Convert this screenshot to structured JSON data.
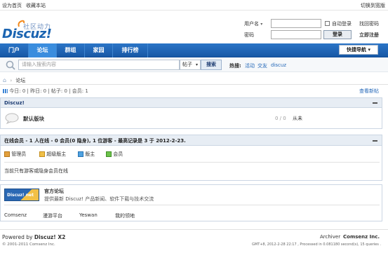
{
  "topbar": {
    "set_home": "设为首页",
    "bookmark": "收藏本站",
    "switch_width": "切换到宽版"
  },
  "logo": {
    "slogan": "社区动力",
    "wordmark": "Discuz!"
  },
  "login": {
    "username_label": "用户名",
    "password_label": "密码",
    "auto_login": "自动登录",
    "forgot_password": "找回密码",
    "login_button": "登录",
    "register": "立即注册"
  },
  "nav": {
    "items": [
      "门户",
      "论坛",
      "群组",
      "家园",
      "排行榜"
    ],
    "active": "论坛",
    "quick_nav": "快捷导航"
  },
  "search": {
    "placeholder": "请输入搜索内容",
    "type": "帖子",
    "button": "搜索",
    "hot_label": "热搜:",
    "hot_terms": [
      "活动",
      "交友",
      "discuz"
    ]
  },
  "breadcrumb": {
    "current": "论坛"
  },
  "stats": {
    "text": "今日: 0 | 昨日: 0 | 帖子: 0 | 会员: 1",
    "new_posts": "查看新帖"
  },
  "category": {
    "name": "Discuz!",
    "forum_name": "默认版块",
    "counts": "0 / 0",
    "last_post": "从未"
  },
  "online": {
    "title": "在线会员 - 1 人在线 - 0 会员(0 隐身), 1 位游客 - 最高记录是 3 于 2012-2-23.",
    "legend": [
      "管理员",
      "超级版主",
      "版主",
      "会员"
    ],
    "note": "当前只有游客或隐身会员在线"
  },
  "links": {
    "title": "官方论坛",
    "desc": "提供最新 Discuz! 产品新闻、软件下载与技术交流",
    "logo_text": "Discuz! net",
    "friends": [
      "Comsenz",
      "漫游平台",
      "Yeswan",
      "我的领地"
    ]
  },
  "footer": {
    "powered": "Powered by",
    "product": "Discuz! X2",
    "copyright": "© 2001-2011 Comsenz Inc.",
    "archiver": "Archiver",
    "company": "Comsenz Inc.",
    "timing": "GMT+8, 2012-2-28 22:17 , Processed in 0.081180 second(s), 15 queries ."
  },
  "colors": {
    "nav_blue": "#1b64b1",
    "link_blue": "#2367b8"
  }
}
